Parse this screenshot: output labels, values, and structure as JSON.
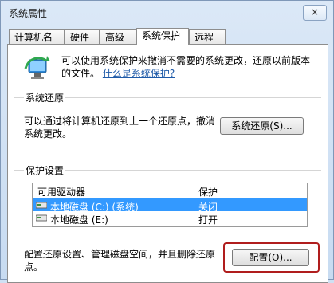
{
  "window": {
    "title": "系统属性",
    "close_label": "×"
  },
  "tabs": [
    {
      "label": "计算机名",
      "active": false
    },
    {
      "label": "硬件",
      "active": false
    },
    {
      "label": "高级",
      "active": false
    },
    {
      "label": "系统保护",
      "active": true
    },
    {
      "label": "远程",
      "active": false
    }
  ],
  "intro": {
    "text": "可以使用系统保护来撤消不需要的系统更改，还原以前版本的文件。",
    "link": "什么是系统保护?"
  },
  "restore": {
    "title": "系统还原",
    "description": "可以通过将计算机还原到上一个还原点，撤消系统更改。",
    "button": "系统还原(S)..."
  },
  "protection": {
    "title": "保护设置",
    "headers": {
      "drive": "可用驱动器",
      "protect": "保护"
    },
    "rows": [
      {
        "drive": "本地磁盘 (C:) (系统)",
        "protect": "关闭",
        "selected": true
      },
      {
        "drive": "本地磁盘 (E:)",
        "protect": "打开",
        "selected": false
      }
    ],
    "config_text": "配置还原设置、管理磁盘空间，并且删除还原点。",
    "config_button": "配置(O)..."
  },
  "colors": {
    "selection": "#3399ff",
    "highlight": "#b01d1d",
    "link": "#1e5aa8"
  }
}
